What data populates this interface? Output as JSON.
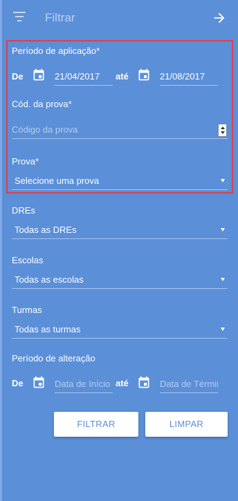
{
  "header": {
    "title": "Filtrar",
    "menu_icon": "filter-list-icon",
    "arrow_icon": "arrow-right-icon"
  },
  "aplicacao": {
    "label": "Período de aplicação*",
    "de_label": "De",
    "ate_label": "até",
    "start_value": "21/04/2017",
    "end_value": "21/08/2017"
  },
  "codigo": {
    "label": "Cód. da prova*",
    "placeholder": "Código da prova"
  },
  "prova": {
    "label": "Prova*",
    "value": "Selecione uma prova"
  },
  "dres": {
    "label": "DREs",
    "value": "Todas as DREs"
  },
  "escolas": {
    "label": "Escolas",
    "value": "Todas as escolas"
  },
  "turmas": {
    "label": "Turmas",
    "value": "Todas as turmas"
  },
  "alteracao": {
    "label": "Período de alteração",
    "de_label": "De",
    "ate_label": "até",
    "start_placeholder": "Data de Início",
    "end_placeholder": "Data de Términ"
  },
  "buttons": {
    "filtrar": "FILTRAR",
    "limpar": "LIMPAR"
  },
  "colors": {
    "panel_bg": "#5b8fd8",
    "highlight_border": "#d9404e",
    "button_bg": "#ffffff",
    "button_text": "#5b8fd8"
  }
}
